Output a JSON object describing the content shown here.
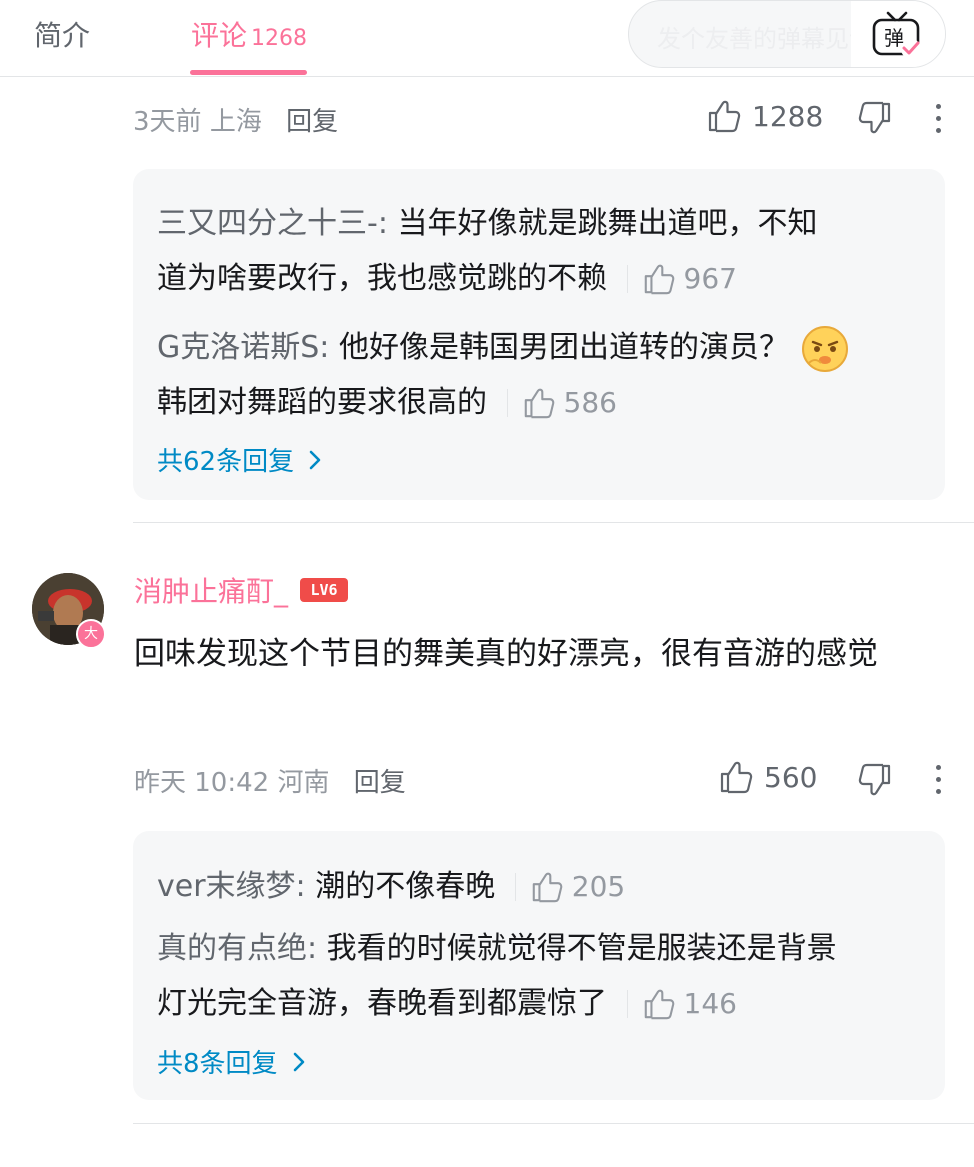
{
  "tabs": {
    "intro": "简介",
    "comments": "评论",
    "comments_count": "1268"
  },
  "danmaku": {
    "placeholder": "发个友善的弹幕见证当下",
    "toggle_label": "弹"
  },
  "comments": [
    {
      "meta_time": "3天前",
      "meta_location": "上海",
      "reply_label": "回复",
      "likes": "1288",
      "replies": [
        {
          "user": "三又四分之十三-",
          "text_line1": "当年好像就是跳舞出道吧，不知",
          "text_line2": "道为啥要改行，我也感觉跳的不赖",
          "likes": "967"
        },
        {
          "user": "G克洛诺斯S",
          "text_line1": "他好像是韩国男团出道转的演员？",
          "text_line2": "韩团对舞蹈的要求很高的",
          "likes": "586",
          "emoji": "thinking-emoji"
        }
      ],
      "more_replies": "共62条回复"
    },
    {
      "user": "消肿止痛酊_",
      "level": "LV6",
      "avatar_badge": "大",
      "text": "回味发现这个节目的舞美真的好漂亮，很有音游的感觉",
      "meta_time": "昨天 10:42",
      "meta_location": "河南",
      "reply_label": "回复",
      "likes": "560",
      "replies": [
        {
          "user": "ver末缘梦",
          "text_line1": "潮的不像春晚",
          "likes": "205"
        },
        {
          "user": "真的有点绝",
          "text_line1": "我看的时候就觉得不管是服装还是背景",
          "text_line2": "灯光完全音游，春晚看到都震惊了",
          "likes": "146"
        }
      ],
      "more_replies": "共8条回复"
    }
  ],
  "colors": {
    "accent_pink": "#fb7299",
    "link_blue": "#008ac5",
    "level_red": "#f04c49",
    "panel_bg": "#f6f7f8"
  }
}
